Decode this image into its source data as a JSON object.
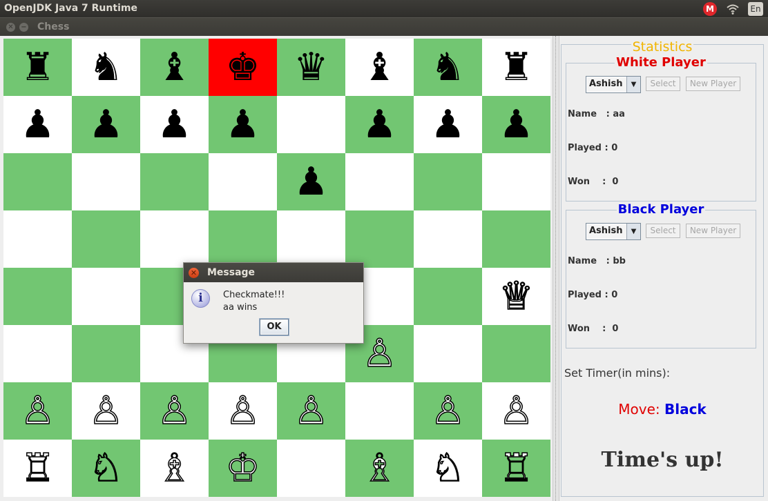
{
  "topbar": {
    "app_title": "OpenJDK Java 7 Runtime",
    "tray_m": "M",
    "tray_wifi_icon": "wifi-icon",
    "tray_lang": "En"
  },
  "window": {
    "title": "Chess",
    "close_glyph": "✕",
    "minimize_glyph": "−"
  },
  "board": {
    "light_color": "#ffffff",
    "dark_color": "#72c672",
    "check_color": "#ff0000",
    "squares": [
      [
        "♜",
        "♞",
        "♝",
        "♚",
        "♛",
        "♝",
        "♞",
        "♜"
      ],
      [
        "♟",
        "♟",
        "♟",
        "♟",
        "",
        "♟",
        "♟",
        "♟"
      ],
      [
        "",
        "",
        "",
        "",
        "♟",
        "",
        "",
        ""
      ],
      [
        "",
        "",
        "",
        "",
        "",
        "",
        "",
        ""
      ],
      [
        "",
        "",
        "",
        "",
        "",
        "",
        "",
        "♕"
      ],
      [
        "",
        "",
        "",
        "",
        "",
        "♙",
        "",
        ""
      ],
      [
        "♙",
        "♙",
        "♙",
        "♙",
        "♙",
        "",
        "♙",
        "♙"
      ],
      [
        "♖",
        "♘",
        "♗",
        "♔",
        "",
        "♗",
        "♘",
        "♖"
      ]
    ]
  },
  "stats": {
    "title": "Statistics",
    "white": {
      "heading": "White Player",
      "selected": "Ashish",
      "select_label": "Select",
      "new_player_label": "New Player",
      "name": "Name   : aa",
      "played": "Played : 0",
      "won": "Won    :  0"
    },
    "black": {
      "heading": "Black Player",
      "selected": "Ashish",
      "select_label": "Select",
      "new_player_label": "New Player",
      "name": "Name   : bb",
      "played": "Played : 0",
      "won": "Won    :  0"
    },
    "timer_label": "Set Timer(in mins):",
    "move_label": "Move:",
    "move_value": "Black",
    "times_up": "Time's up!"
  },
  "dialog": {
    "title": "Message",
    "icon": "info-icon",
    "icon_glyph": "i",
    "line1": "Checkmate!!!",
    "line2": "aa wins",
    "ok_label": "OK",
    "close_glyph": "✕"
  }
}
